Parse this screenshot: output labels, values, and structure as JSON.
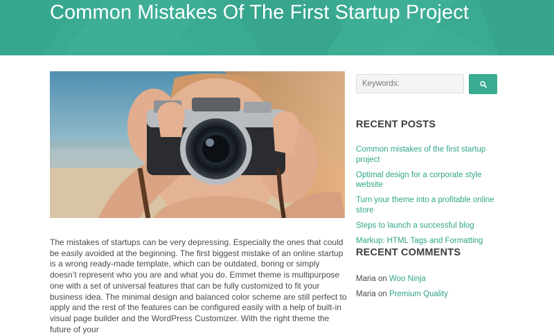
{
  "post": {
    "title": "Common Mistakes Of The First Startup Project",
    "body": "The mistakes of startups can be very depressing. Especially the ones that could be easily avoided at the beginning. The first biggest mistake of an online startup is a wrong ready-made template, which can be outdated, boring or simply doesn’t represent who you are and what you do. Emmet theme is multipurpose one with a set of universal features that can be fully customized to fit your business idea. The minimal design and balanced color scheme are still perfect to apply and the rest of the features can be configured easily with a help of built-in visual page builder and the WordPress Customizer. With the right theme the future of your"
  },
  "search": {
    "placeholder": "Keywords:",
    "button_icon": "search-icon"
  },
  "recent_posts": {
    "heading": "RECENT POSTS",
    "items": [
      "Common mistakes of the first startup project",
      "Optimal design for a corporate style website",
      "Turn your theme into a profitable online store",
      "Steps to launch a successful blog",
      "Markup: HTML Tags and Formatting"
    ]
  },
  "recent_comments": {
    "heading": "RECENT COMMENTS",
    "items": [
      {
        "author": "Maria",
        "on": "on",
        "post": "Woo Ninja"
      },
      {
        "author": "Maria",
        "on": "on",
        "post": "Premium Quality"
      }
    ]
  },
  "colors": {
    "accent": "#3aaa92",
    "link": "#2fa58a",
    "heading": "#3d3d3d",
    "text": "#4a4a4a"
  },
  "image": {
    "subject": "woman-holding-camera-photo"
  }
}
